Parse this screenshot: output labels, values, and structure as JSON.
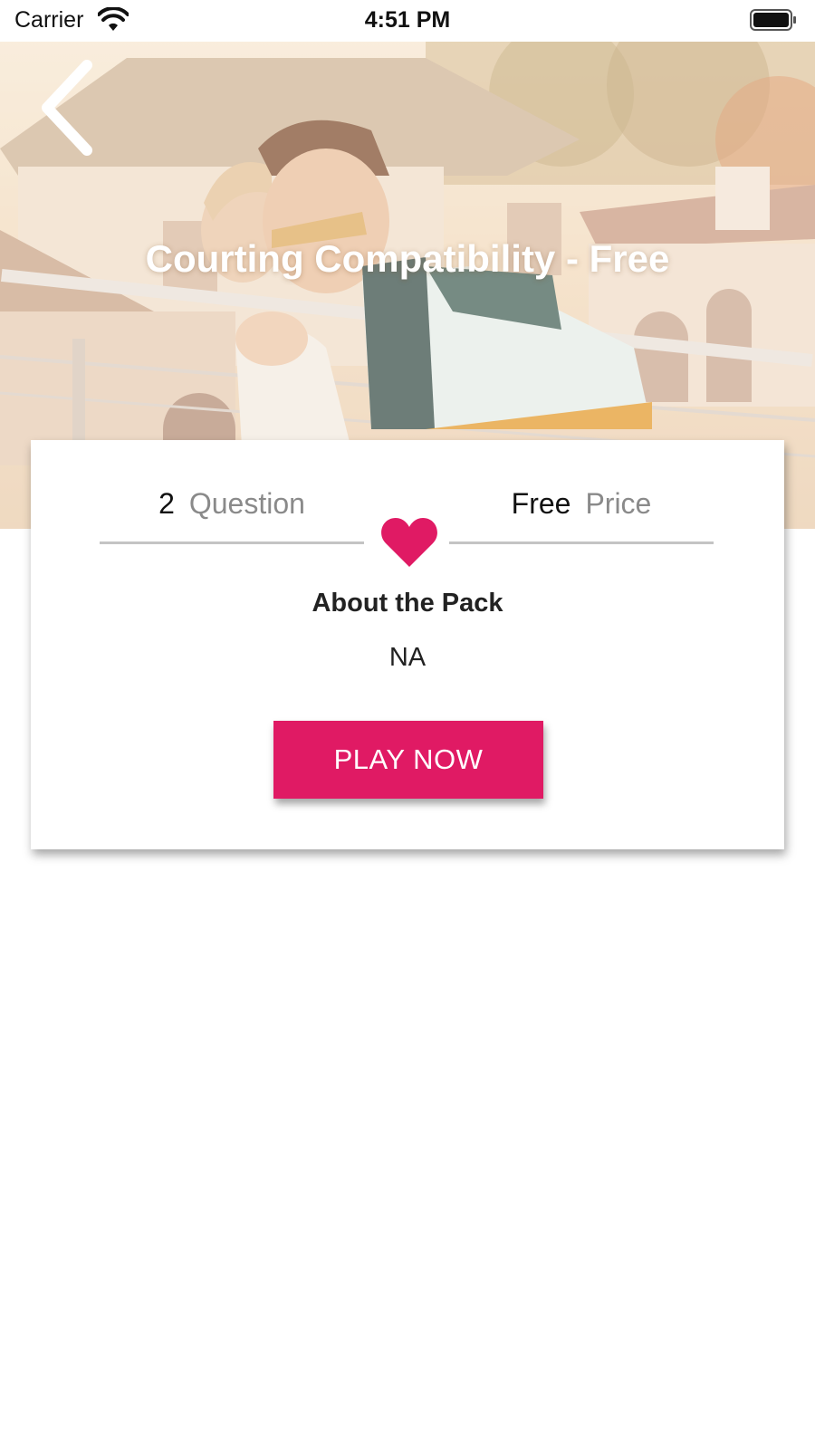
{
  "status_bar": {
    "carrier": "Carrier",
    "time": "4:51 PM",
    "wifi_icon": "wifi-icon",
    "battery_icon": "battery-icon"
  },
  "hero": {
    "title": "Courting Compatibility - Free",
    "back_icon": "chevron-left-icon",
    "image": "couple-photo"
  },
  "card": {
    "questions_value": "2",
    "questions_label": "Question",
    "price_value": "Free",
    "price_label": "Price",
    "divider_icon": "heart-icon",
    "about_title": "About the Pack",
    "about_text": "NA",
    "play_button_label": "PLAY NOW"
  },
  "colors": {
    "accent": "#e01a64",
    "text_primary": "#222222",
    "text_secondary": "#8a8a8a",
    "divider": "#c4c4c4"
  }
}
